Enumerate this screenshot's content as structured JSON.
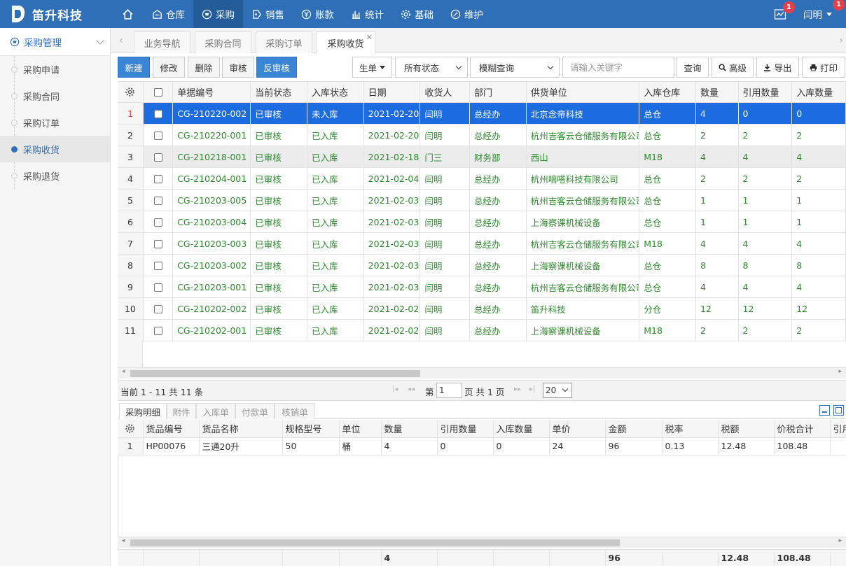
{
  "app": {
    "title": "笛升科技"
  },
  "nav": [
    {
      "label": "",
      "icon": "home-icon"
    },
    {
      "label": "仓库",
      "icon": "warehouse-icon"
    },
    {
      "label": "采购",
      "icon": "cart-icon"
    },
    {
      "label": "销售",
      "icon": "tag-icon"
    },
    {
      "label": "账款",
      "icon": "yen-icon"
    },
    {
      "label": "统计",
      "icon": "bar-chart-icon"
    },
    {
      "label": "基础",
      "icon": "gear-icon"
    },
    {
      "label": "维护",
      "icon": "wrench-icon"
    }
  ],
  "topright": {
    "message_badge": "1",
    "user_name": "闫明",
    "user_badge": "1"
  },
  "sidebar": {
    "header": "采购管理",
    "items": [
      {
        "label": "采购申请"
      },
      {
        "label": "采购合同"
      },
      {
        "label": "采购订单"
      },
      {
        "label": "采购收货"
      },
      {
        "label": "采购退货"
      }
    ]
  },
  "tabs": [
    {
      "label": "业务导航"
    },
    {
      "label": "采购合同"
    },
    {
      "label": "采购订单"
    },
    {
      "label": "采购收货"
    }
  ],
  "toolbar": {
    "new": "新建",
    "edit": "修改",
    "delete": "删除",
    "audit": "审核",
    "unaudit": "反审核",
    "generate": "生单",
    "status_select": "所有状态",
    "query_mode": "模糊查询",
    "keyword_placeholder": "请输入关键字",
    "search": "查询",
    "advanced": "高级",
    "export": "导出",
    "print": "打印"
  },
  "grid": {
    "headers": [
      "单据编号",
      "当前状态",
      "入库状态",
      "日期",
      "收货人",
      "部门",
      "供货单位",
      "入库仓库",
      "数量",
      "引用数量",
      "入库数量"
    ],
    "rows": [
      [
        "1",
        "CG-210220-002",
        "已审核",
        "未入库",
        "2021-02-20",
        "闫明",
        "总经办",
        "北京念帝科技",
        "总仓",
        "4",
        "0",
        "0"
      ],
      [
        "2",
        "CG-210220-001",
        "已审核",
        "已入库",
        "2021-02-20",
        "闫明",
        "总经办",
        "杭州吉客云仓储服务有限公司",
        "总仓",
        "2",
        "2",
        "2"
      ],
      [
        "3",
        "CG-210218-001",
        "已审核",
        "已入库",
        "2021-02-18",
        "门三",
        "财务部",
        "西山",
        "M18",
        "4",
        "4",
        "4"
      ],
      [
        "4",
        "CG-210204-001",
        "已审核",
        "已入库",
        "2021-02-04",
        "闫明",
        "总经办",
        "杭州嘀嗒科技有限公司",
        "总仓",
        "2",
        "2",
        "2"
      ],
      [
        "5",
        "CG-210203-005",
        "已审核",
        "已入库",
        "2021-02-03",
        "闫明",
        "总经办",
        "杭州吉客云仓储服务有限公司",
        "总仓",
        "1",
        "1",
        "1"
      ],
      [
        "6",
        "CG-210203-004",
        "已审核",
        "已入库",
        "2021-02-03",
        "闫明",
        "总经办",
        "上海察课机械设备",
        "总仓",
        "1",
        "1",
        "1"
      ],
      [
        "7",
        "CG-210203-003",
        "已审核",
        "已入库",
        "2021-02-03",
        "闫明",
        "总经办",
        "杭州吉客云仓储服务有限公司",
        "M18",
        "4",
        "4",
        "4"
      ],
      [
        "8",
        "CG-210203-002",
        "已审核",
        "已入库",
        "2021-02-03",
        "闫明",
        "总经办",
        "上海察课机械设备",
        "总仓",
        "8",
        "8",
        "8"
      ],
      [
        "9",
        "CG-210203-001",
        "已审核",
        "已入库",
        "2021-02-03",
        "闫明",
        "总经办",
        "杭州吉客云仓储服务有限公司",
        "总仓",
        "4",
        "4",
        "4"
      ],
      [
        "10",
        "CG-210202-002",
        "已审核",
        "已入库",
        "2021-02-02",
        "闫明",
        "总经办",
        "笛升科技",
        "分仓",
        "12",
        "12",
        "12"
      ],
      [
        "11",
        "CG-210202-001",
        "已审核",
        "已入库",
        "2021-02-02",
        "闫明",
        "总经办",
        "上海察课机械设备",
        "M18",
        "2",
        "2",
        "2"
      ]
    ]
  },
  "pager": {
    "info": "当前 1 - 11 共 11 条",
    "page_prefix": "第",
    "page": "1",
    "page_suffix": "页 共 1 页",
    "page_size": "20"
  },
  "detail_tabs": [
    {
      "label": "采购明细"
    },
    {
      "label": "附件"
    },
    {
      "label": "入库单"
    },
    {
      "label": "付款单"
    },
    {
      "label": "核销单"
    }
  ],
  "detail": {
    "headers": [
      "货品编号",
      "货品名称",
      "规格型号",
      "单位",
      "数量",
      "引用数量",
      "入库数量",
      "单价",
      "金额",
      "税率",
      "税额",
      "价税合计",
      "引用"
    ],
    "rows": [
      [
        "1",
        "HP00076",
        "三通20升",
        "50",
        "桶",
        "4",
        "0",
        "0",
        "24",
        "96",
        "0.13",
        "12.48",
        "108.48",
        ""
      ]
    ],
    "footer": [
      "",
      "",
      "",
      "",
      "",
      "4",
      "",
      "",
      "",
      "96",
      "",
      "12.48",
      "108.48",
      ""
    ]
  },
  "colors": {
    "brand": "#2f6fb7",
    "selected_row": "#1c6ce0",
    "status_text": "#2c8a2c"
  }
}
